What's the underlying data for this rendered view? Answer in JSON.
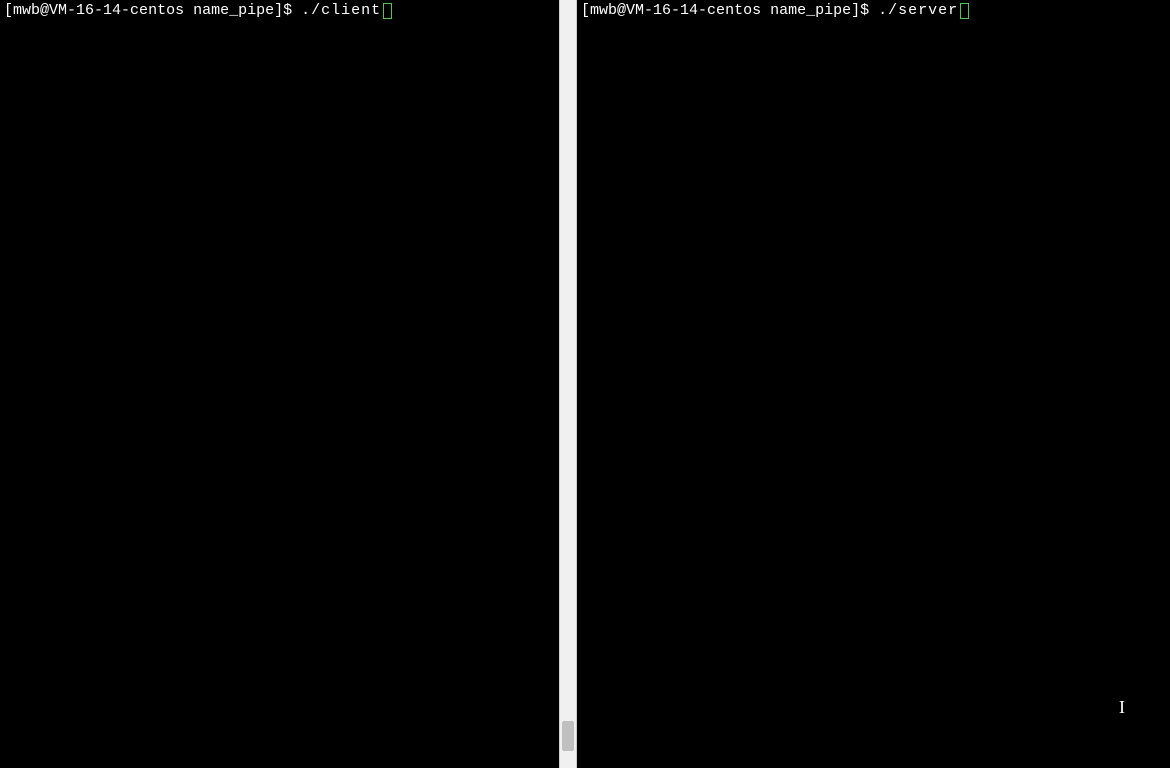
{
  "left": {
    "user": "mwb",
    "host": "VM-16-14-centos",
    "dir": "name_pipe",
    "command": "./client"
  },
  "right": {
    "user": "mwb",
    "host": "VM-16-14-centos",
    "dir": "name_pipe",
    "command": "./server"
  }
}
